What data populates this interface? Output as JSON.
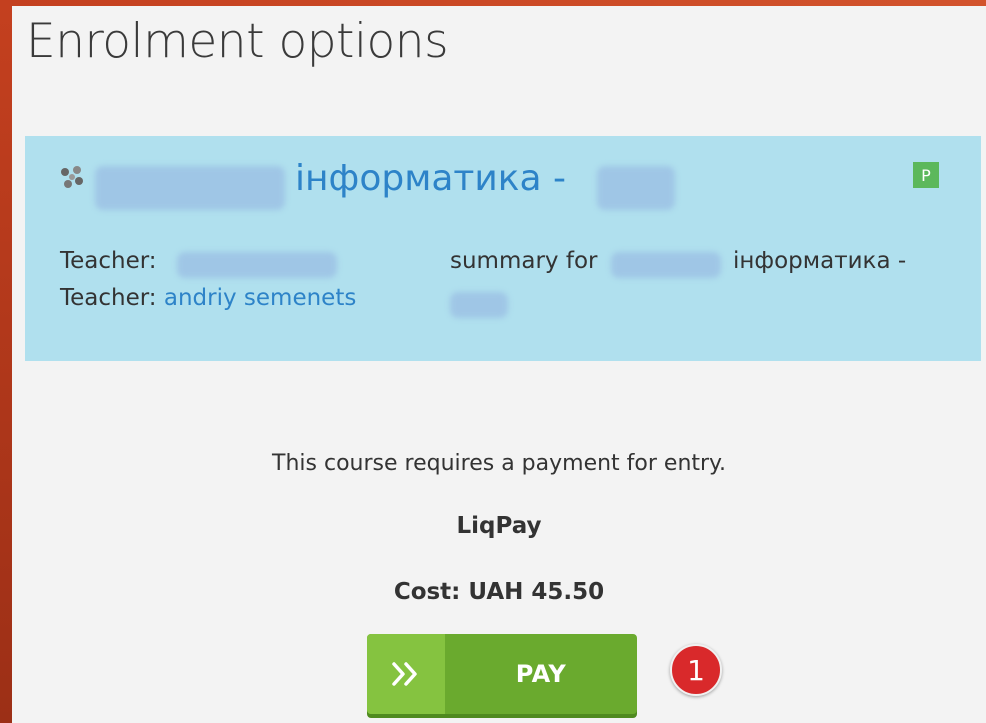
{
  "page": {
    "title": "Enrolment options"
  },
  "course": {
    "name_visible": "інформатика -",
    "badge": "P",
    "teacher_label_1": "Teacher:",
    "teacher_label_2": "Teacher:",
    "teacher_name_2": "andriy semenets",
    "summary_prefix": "summary for",
    "summary_suffix": "інформатика -",
    "icon": "course-network-icon"
  },
  "payment": {
    "message": "This course requires a payment for entry.",
    "gateway": "LiqPay",
    "cost": "Cost: UAH 45.50",
    "pay_label": "PAY",
    "pay_icon": "double-chevron-right-icon",
    "step_number": "1"
  },
  "colors": {
    "frame": "#b5391c",
    "course_bg": "#b0e0ee",
    "link": "#2d83c8",
    "button_green": "#6aaa2e",
    "badge_green": "#5cb85c",
    "step_red": "#d9292b"
  }
}
